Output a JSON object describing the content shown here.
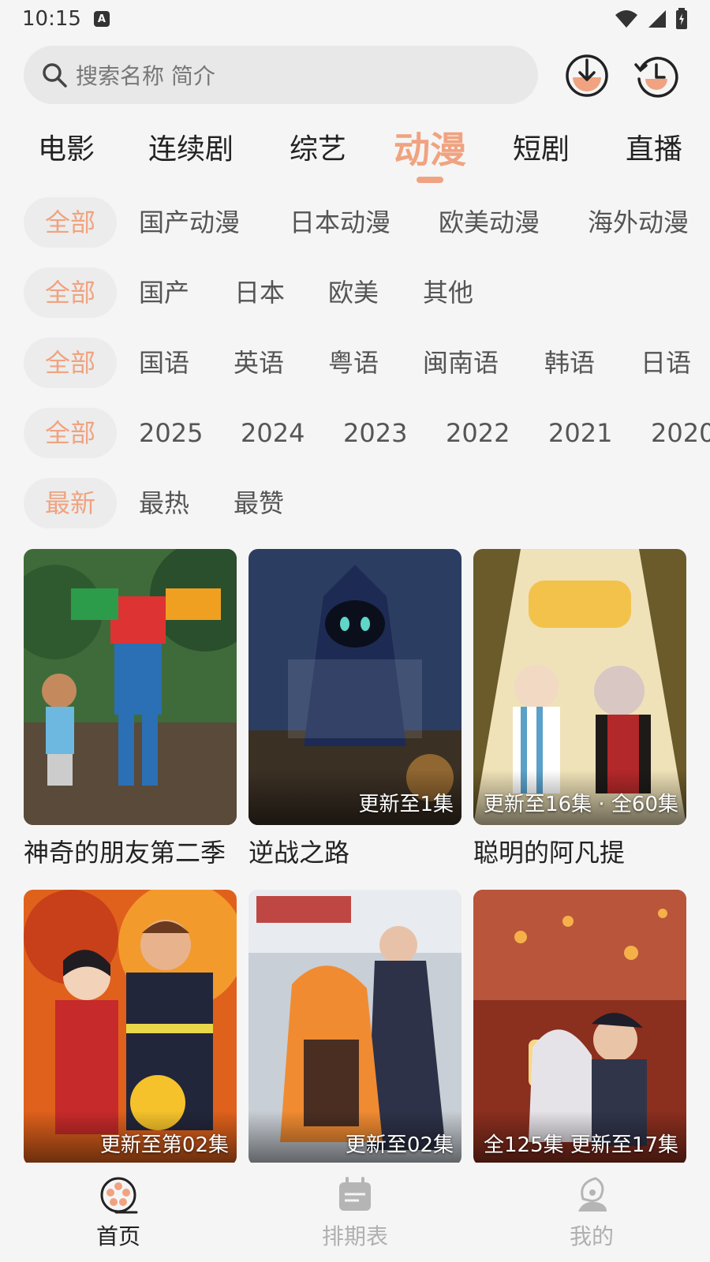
{
  "status": {
    "time": "10:15",
    "a_badge": "A"
  },
  "search": {
    "placeholder": "搜索名称 简介"
  },
  "categories": [
    "电影",
    "连续剧",
    "综艺",
    "动漫",
    "短剧",
    "直播"
  ],
  "active_category": "动漫",
  "filters": {
    "type": [
      "全部",
      "国产动漫",
      "日本动漫",
      "欧美动漫",
      "海外动漫"
    ],
    "region": [
      "全部",
      "国产",
      "日本",
      "欧美",
      "其他"
    ],
    "language": [
      "全部",
      "国语",
      "英语",
      "粤语",
      "闽南语",
      "韩语",
      "日语"
    ],
    "year": [
      "全部",
      "2025",
      "2024",
      "2023",
      "2022",
      "2021",
      "2020"
    ],
    "sort": [
      "最新",
      "最热",
      "最赞"
    ]
  },
  "cards": [
    {
      "title": "神奇的朋友第二季",
      "badge": ""
    },
    {
      "title": "逆战之路",
      "badge": "更新至1集"
    },
    {
      "title": "聪明的阿凡提",
      "badge": "更新至16集 · 全60集"
    },
    {
      "title": "",
      "badge": "更新至第02集"
    },
    {
      "title": "",
      "badge": "更新至02集"
    },
    {
      "title": "",
      "badge": "全125集 更新至17集"
    }
  ],
  "nav": {
    "home": "首页",
    "schedule": "排期表",
    "mine": "我的"
  },
  "colors": {
    "accent": "#f0a380",
    "background": "#f5f5f5"
  }
}
